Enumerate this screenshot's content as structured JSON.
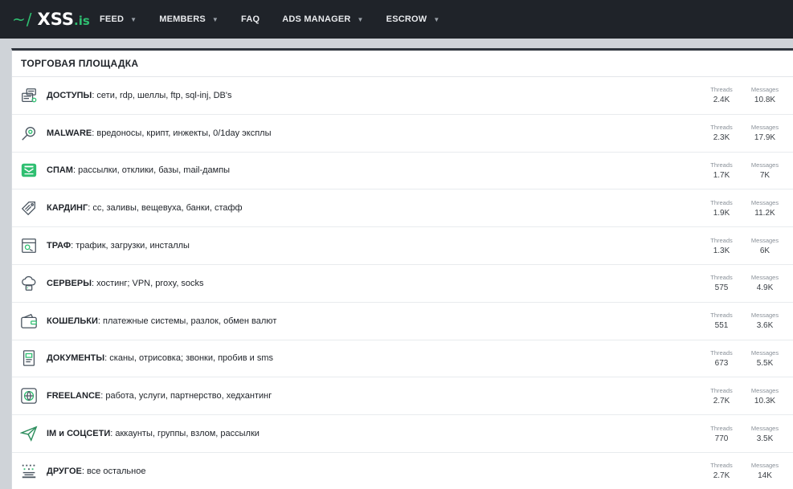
{
  "logo": {
    "prefix": "~/",
    "main": "XSS",
    "suffix": ".is"
  },
  "nav": [
    {
      "label": "FEED",
      "caret": "▼"
    },
    {
      "label": "MEMBERS",
      "caret": "▼"
    },
    {
      "label": "FAQ",
      "caret": ""
    },
    {
      "label": "ADS MANAGER",
      "caret": "▼"
    },
    {
      "label": "ESCROW",
      "caret": "▼"
    }
  ],
  "section": {
    "title": "ТОРГОВАЯ ПЛОЩАДКА",
    "threads_label": "Threads",
    "messages_label": "Messages"
  },
  "forums": [
    {
      "icon": "server-access-icon",
      "title": "ДОСТУПЫ",
      "desc": ": сети, rdp, шеллы, ftp, sql-inj, DB's",
      "threads": "2.4K",
      "messages": "10.8K"
    },
    {
      "icon": "malware-search-icon",
      "title": "MALWARE",
      "desc": ": вредоносы, крипт, инжекты, 0/1day эксплы",
      "threads": "2.3K",
      "messages": "17.9K"
    },
    {
      "icon": "spam-mail-icon",
      "title": "СПАМ",
      "desc": ": рассылки, отклики, базы, mail-дампы",
      "threads": "1.7K",
      "messages": "7K"
    },
    {
      "icon": "card-tag-icon",
      "title": "КАРДИНГ",
      "desc": ": cc, заливы, вещевуха, банки, стафф",
      "threads": "1.9K",
      "messages": "11.2K"
    },
    {
      "icon": "traffic-icon",
      "title": "ТРАФ",
      "desc": ": трафик, загрузки, инсталлы",
      "threads": "1.3K",
      "messages": "6K"
    },
    {
      "icon": "cloud-server-icon",
      "title": "СЕРВЕРЫ",
      "desc": ": хостинг; VPN, proxy, socks",
      "threads": "575",
      "messages": "4.9K"
    },
    {
      "icon": "wallet-icon",
      "title": "КОШЕЛЬКИ",
      "desc": ": платежные системы, разлок, обмен валют",
      "threads": "551",
      "messages": "3.6K"
    },
    {
      "icon": "document-icon",
      "title": "ДОКУМЕНТЫ",
      "desc": ": сканы, отрисовка; звонки, пробив и sms",
      "threads": "673",
      "messages": "5.5K"
    },
    {
      "icon": "freelance-globe-icon",
      "title": "FREELANCE",
      "desc": ": работа, услуги, партнерство, хедхантинг",
      "threads": "2.7K",
      "messages": "10.3K"
    },
    {
      "icon": "paper-plane-icon",
      "title": "IM и СОЦСЕТИ",
      "desc": ": аккаунты, группы, взлом, рассылки",
      "threads": "770",
      "messages": "3.5K"
    },
    {
      "icon": "misc-grid-icon",
      "title": "ДРУГОЕ",
      "desc": ": все остальное",
      "threads": "2.7K",
      "messages": "14K"
    }
  ],
  "colors": {
    "accent": "#2fbf71",
    "topbar": "#1f2329",
    "icon": "#4a5560"
  }
}
